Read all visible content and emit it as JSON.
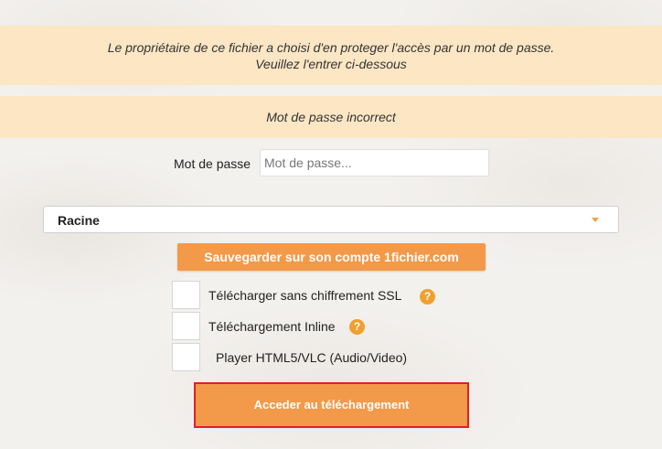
{
  "notice": {
    "line1": "Le propriétaire de ce fichier a choisi d'en proteger l'accès par un mot de passe.",
    "line2": "Veuillez l'entrer ci-dessous"
  },
  "error": {
    "message": "Mot de passe incorrect"
  },
  "password": {
    "label": "Mot de passe",
    "placeholder": "Mot de passe...",
    "value": ""
  },
  "folder_select": {
    "selected": "Racine",
    "caret_icon": "caret-down-icon",
    "caret_color": "#f0a04b"
  },
  "save_button": {
    "label": "Sauvegarder sur son compte 1fichier.com"
  },
  "options": [
    {
      "label": "Télécharger sans chiffrement SSL",
      "checked": false,
      "help": "?"
    },
    {
      "label": "Téléchargement Inline",
      "checked": false,
      "help": "?"
    },
    {
      "label": "Player HTML5/VLC (Audio/Video)",
      "checked": false
    }
  ],
  "download_button": {
    "label": "Acceder au téléchargement",
    "highlight_color": "#e31e24"
  },
  "colors": {
    "accent": "#f2994a",
    "notice_bg": "#fce6c4",
    "help_icon": "#f0a02e"
  }
}
